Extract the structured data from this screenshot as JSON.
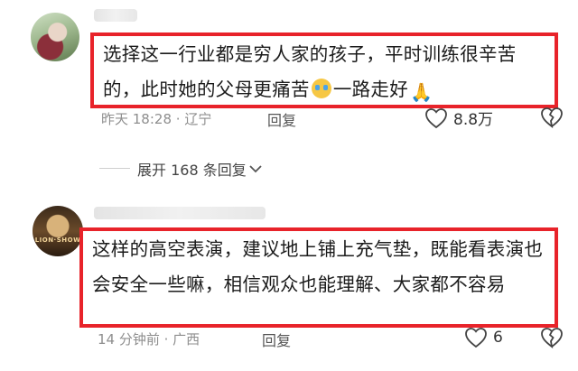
{
  "comments": [
    {
      "text_a": "选择这一行业都是穷人家的孩子，平时训练很辛苦的，此时她的父母更痛苦",
      "text_b": "一路走好",
      "emoji_1": "crying-face",
      "emoji_2": "folded-hands",
      "time": "昨天 18:28",
      "location": "辽宁",
      "reply_label": "回复",
      "likes": "8.8万"
    },
    {
      "text": "这样的高空表演，建议地上铺上充气垫，既能看表演也会安全一些嘛，相信观众也能理解、大家都不容易",
      "time": "14 分钟前",
      "location": "广西",
      "reply_label": "回复",
      "likes": "6"
    }
  ],
  "expand": {
    "label": "展开 168 条回复",
    "icon": "chevron-down-icon"
  },
  "colors": {
    "highlight_border": "#e8232a",
    "meta_text": "#8e8e8e"
  }
}
